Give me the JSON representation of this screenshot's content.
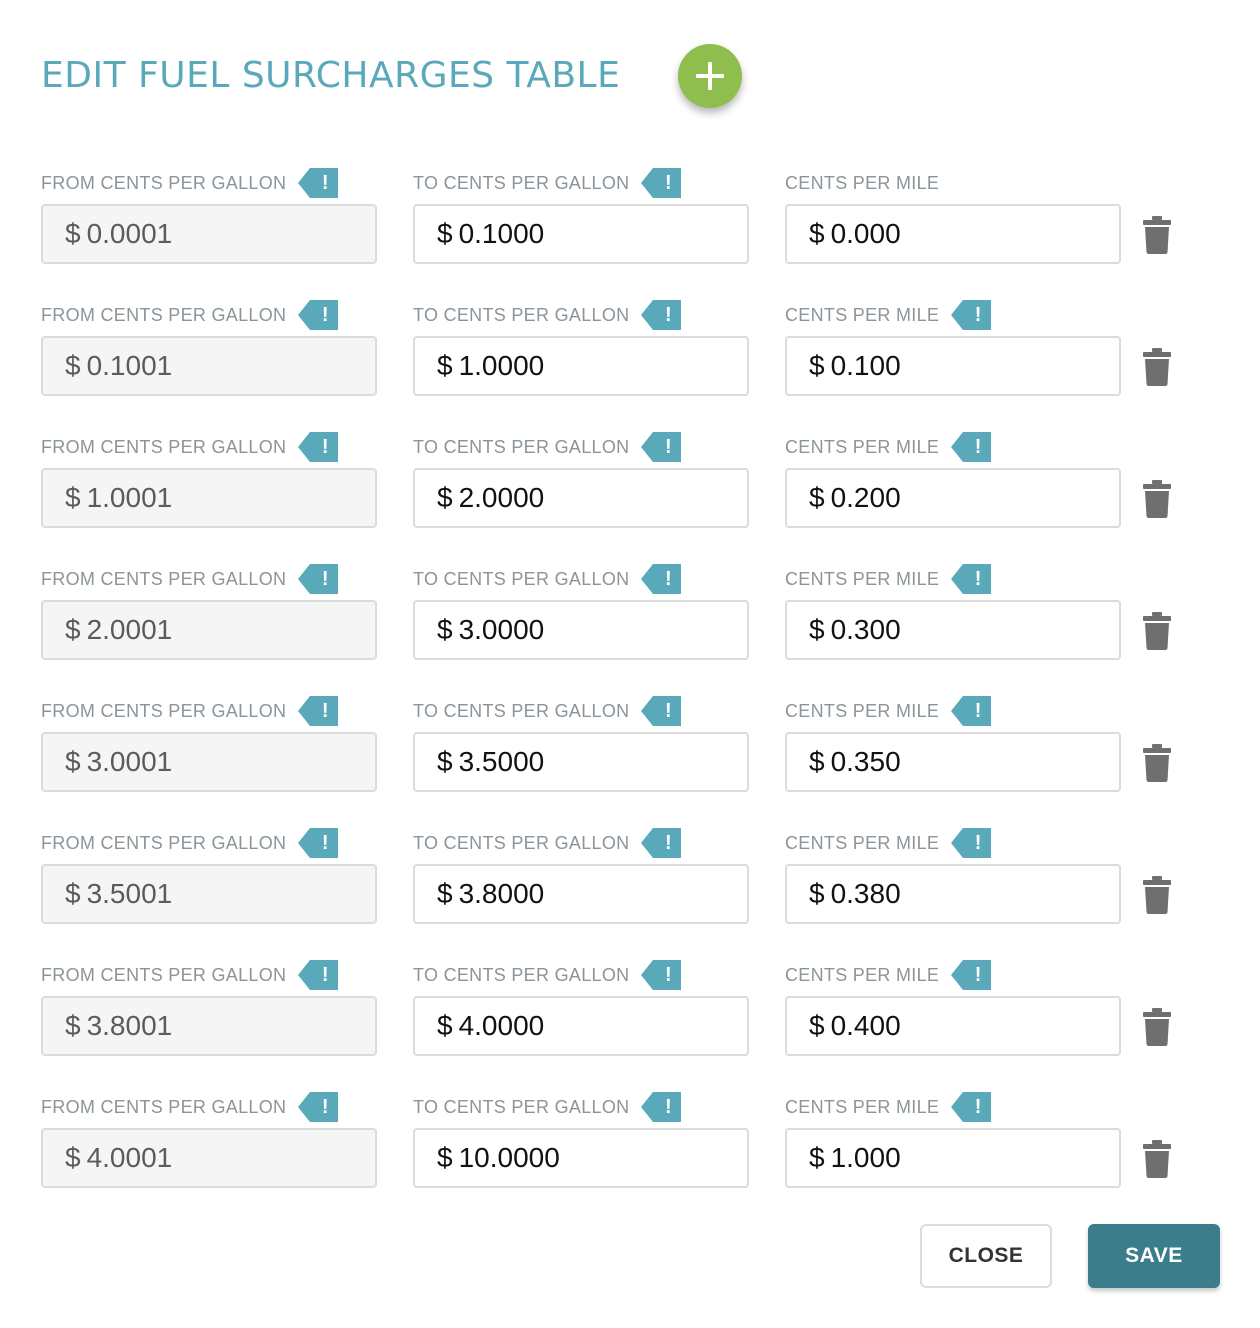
{
  "title": "EDIT FUEL SURCHARGES TABLE",
  "colors": {
    "title": "#5aa9bb",
    "add_button": "#8fbd4e",
    "warning_tag": "#5aa9bb",
    "save_button": "#3b7d8b",
    "trash_icon": "#6f6f6f"
  },
  "labels": {
    "from": "FROM CENTS PER GALLON",
    "to": "TO CENTS PER GALLON",
    "cpm": "CENTS PER MILE",
    "currency": "$",
    "warning": "!"
  },
  "rows": [
    {
      "from": "0.0001",
      "to": "0.1000",
      "cpm": "0.000",
      "from_warn": true,
      "to_warn": true,
      "cpm_warn": false
    },
    {
      "from": "0.1001",
      "to": "1.0000",
      "cpm": "0.100",
      "from_warn": true,
      "to_warn": true,
      "cpm_warn": true
    },
    {
      "from": "1.0001",
      "to": "2.0000",
      "cpm": "0.200",
      "from_warn": true,
      "to_warn": true,
      "cpm_warn": true
    },
    {
      "from": "2.0001",
      "to": "3.0000",
      "cpm": "0.300",
      "from_warn": true,
      "to_warn": true,
      "cpm_warn": true
    },
    {
      "from": "3.0001",
      "to": "3.5000",
      "cpm": "0.350",
      "from_warn": true,
      "to_warn": true,
      "cpm_warn": true
    },
    {
      "from": "3.5001",
      "to": "3.8000",
      "cpm": "0.380",
      "from_warn": true,
      "to_warn": true,
      "cpm_warn": true
    },
    {
      "from": "3.8001",
      "to": "4.0000",
      "cpm": "0.400",
      "from_warn": true,
      "to_warn": true,
      "cpm_warn": true
    },
    {
      "from": "4.0001",
      "to": "10.0000",
      "cpm": "1.000",
      "from_warn": true,
      "to_warn": true,
      "cpm_warn": true
    }
  ],
  "buttons": {
    "close": "CLOSE",
    "save": "SAVE"
  },
  "icons": {
    "add": "plus-icon",
    "warning": "exclamation-tag-icon",
    "delete": "trash-icon"
  }
}
